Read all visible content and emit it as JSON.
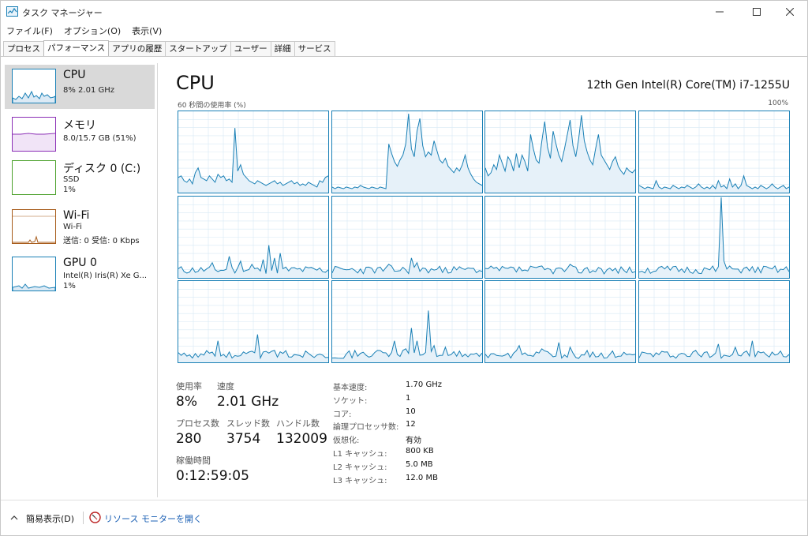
{
  "window": {
    "title": "タスク マネージャー"
  },
  "menu": [
    "ファイル(F)",
    "オプション(O)",
    "表示(V)"
  ],
  "tabs": [
    "プロセス",
    "パフォーマンス",
    "アプリの履歴",
    "スタートアップ",
    "ユーザー",
    "詳細",
    "サービス"
  ],
  "active_tab": "パフォーマンス",
  "sidebar": {
    "items": [
      {
        "title": "CPU",
        "lines": [
          "8%  2.01 GHz"
        ],
        "color": "#1a80b6"
      },
      {
        "title": "メモリ",
        "lines": [
          "8.0/15.7 GB (51%)"
        ],
        "color": "#8b2fb6"
      },
      {
        "title": "ディスク 0 (C:)",
        "lines": [
          "SSD",
          "1%"
        ],
        "color": "#4ca12c"
      },
      {
        "title": "Wi-Fi",
        "lines": [
          "Wi-Fi",
          "送信: 0 受信: 0 Kbps"
        ],
        "color": "#a75b1a"
      },
      {
        "title": "GPU 0",
        "lines": [
          "Intel(R) Iris(R) Xe G...",
          "1%"
        ],
        "color": "#1a80b6"
      }
    ]
  },
  "main": {
    "title": "CPU",
    "model": "12th Gen Intel(R) Core(TM) i7-1255U",
    "axis_left": "60 秒間の使用率 (%)",
    "axis_right": "100%",
    "graph_color": "#1a80b6"
  },
  "stats": {
    "usage_label": "使用率",
    "usage_value": "8%",
    "speed_label": "速度",
    "speed_value": "2.01 GHz",
    "processes_label": "プロセス数",
    "processes_value": "280",
    "threads_label": "スレッド数",
    "threads_value": "3754",
    "handles_label": "ハンドル数",
    "handles_value": "132009",
    "uptime_label": "稼働時間",
    "uptime_value": "0:12:59:05"
  },
  "specs": [
    {
      "key": "基本速度:",
      "value": "1.70 GHz"
    },
    {
      "key": "ソケット:",
      "value": "1"
    },
    {
      "key": "コア:",
      "value": "10"
    },
    {
      "key": "論理プロセッサ数:",
      "value": "12"
    },
    {
      "key": "仮想化:",
      "value": "有効"
    },
    {
      "key": "L1 キャッシュ:",
      "value": "800 KB"
    },
    {
      "key": "L2 キャッシュ:",
      "value": "5.0 MB"
    },
    {
      "key": "L3 キャッシュ:",
      "value": "12.0 MB"
    }
  ],
  "footer": {
    "less_details": "簡易表示(D)",
    "resource_monitor": "リソース モニターを開く"
  },
  "core_graphs": [
    [
      18,
      20,
      14,
      12,
      16,
      10,
      24,
      30,
      18,
      16,
      14,
      20,
      16,
      12,
      22,
      18,
      20,
      14,
      16,
      12,
      80,
      26,
      34,
      22,
      18,
      14,
      12,
      10,
      14,
      12,
      10,
      8,
      10,
      12,
      14,
      10,
      12,
      8,
      10,
      12,
      14,
      10,
      12,
      8,
      10,
      8,
      12,
      10,
      8,
      6,
      14,
      12,
      18,
      20
    ],
    [
      6,
      4,
      6,
      5,
      4,
      6,
      5,
      4,
      6,
      5,
      8,
      6,
      5,
      4,
      6,
      5,
      4,
      6,
      5,
      4,
      60,
      48,
      38,
      32,
      40,
      46,
      60,
      98,
      54,
      44,
      76,
      92,
      58,
      44,
      50,
      46,
      64,
      52,
      40,
      36,
      42,
      32,
      28,
      24,
      30,
      26,
      34,
      46,
      30,
      22,
      16,
      12,
      10,
      8
    ],
    [
      30,
      20,
      24,
      34,
      28,
      46,
      36,
      26,
      44,
      38,
      26,
      48,
      30,
      46,
      38,
      26,
      72,
      54,
      40,
      36,
      64,
      88,
      56,
      42,
      76,
      60,
      46,
      38,
      54,
      72,
      90,
      58,
      44,
      66,
      96,
      64,
      50,
      40,
      34,
      54,
      72,
      46,
      40,
      34,
      28,
      38,
      44,
      32,
      26,
      22,
      30,
      26,
      24,
      28
    ],
    [
      8,
      6,
      4,
      6,
      5,
      4,
      14,
      6,
      4,
      6,
      5,
      4,
      8,
      6,
      4,
      6,
      5,
      8,
      6,
      4,
      6,
      10,
      6,
      4,
      6,
      4,
      8,
      4,
      14,
      6,
      8,
      4,
      16,
      6,
      10,
      4,
      8,
      20,
      8,
      6,
      4,
      6,
      4,
      8,
      6,
      4,
      6,
      10,
      6,
      4,
      6,
      8,
      4,
      6
    ]
  ]
}
